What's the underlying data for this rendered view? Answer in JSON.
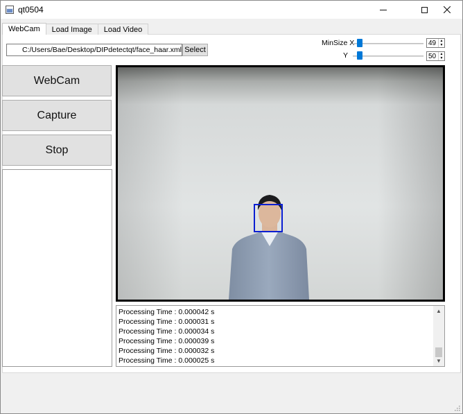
{
  "window": {
    "title": "qt0504"
  },
  "tabs": [
    {
      "label": "WebCam"
    },
    {
      "label": "Load Image"
    },
    {
      "label": "Load Video"
    }
  ],
  "file": {
    "path": "C:/Users/Bae/Desktop/DIPdetectqt/face_haar.xml",
    "select_label": "Select"
  },
  "minsize": {
    "x_label": "MinSize X",
    "y_label": "Y",
    "x_value": "49",
    "y_value": "50",
    "x_slider_fraction": 0.1,
    "y_slider_fraction": 0.1
  },
  "buttons": {
    "webcam": "WebCam",
    "capture": "Capture",
    "stop": "Stop"
  },
  "video": {
    "detection_color": "#0a1ed2"
  },
  "log": {
    "lines": [
      "Processing Time : 0.000042 s",
      "Processing Time : 0.000031 s",
      "Processing Time : 0.000034 s",
      "Processing Time : 0.000039 s",
      "Processing Time : 0.000032 s",
      "Processing Time : 0.000025 s"
    ]
  }
}
